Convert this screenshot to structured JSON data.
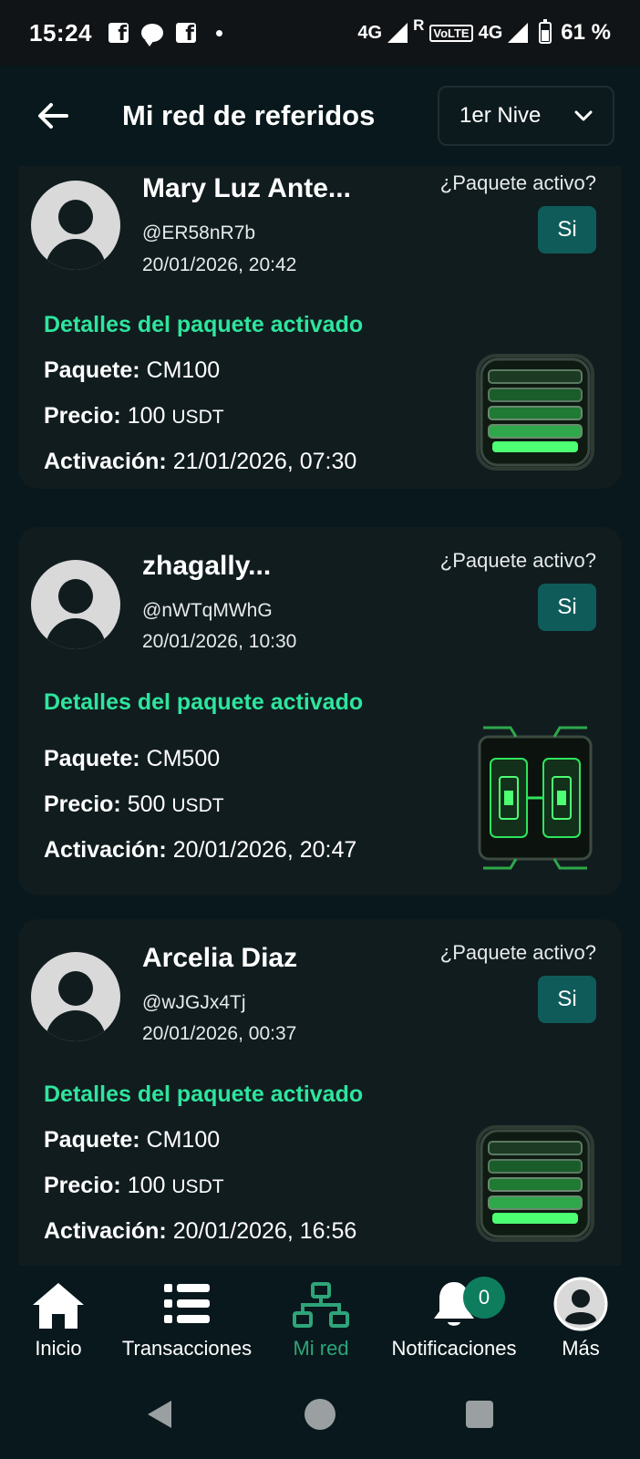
{
  "status_bar": {
    "time": "15:24",
    "network_1": "4G",
    "roaming": "R",
    "volte": "VoLTE",
    "network_2": "4G",
    "battery": "61 %"
  },
  "header": {
    "title": "Mi red de referidos",
    "level_select": "1er Nive"
  },
  "labels": {
    "package_question": "¿Paquete activo?",
    "details_title": "Detalles del paquete activado",
    "package": "Paquete:",
    "price": "Precio:",
    "activation": "Activación:",
    "currency": "USDT"
  },
  "referrals": [
    {
      "name": "Mary Luz Ante...",
      "handle": "@ER58nR7b",
      "date": "20/01/2026, 20:42",
      "active": "Si",
      "package": "CM100",
      "price": "100",
      "activation": "21/01/2026, 07:30"
    },
    {
      "name": "zhagally...",
      "handle": "@nWTqMWhG",
      "date": "20/01/2026, 10:30",
      "active": "Si",
      "package": "CM500",
      "price": "500",
      "activation": "20/01/2026, 20:47"
    },
    {
      "name": "Arcelia Diaz",
      "handle": "@wJGJx4Tj",
      "date": "20/01/2026, 00:37",
      "active": "Si",
      "package": "CM100",
      "price": "100",
      "activation": "20/01/2026, 16:56"
    }
  ],
  "bottom_nav": {
    "items": [
      "Inicio",
      "Transacciones",
      "Mi red",
      "Notificaciones",
      "Más"
    ],
    "active": "Mi red",
    "notification_count": "0"
  },
  "colors": {
    "background": "#08181c",
    "card": "#111c1f",
    "accent_green": "#2ee59d",
    "button_teal": "#0f5b5a",
    "nav_active": "#2ea579"
  }
}
